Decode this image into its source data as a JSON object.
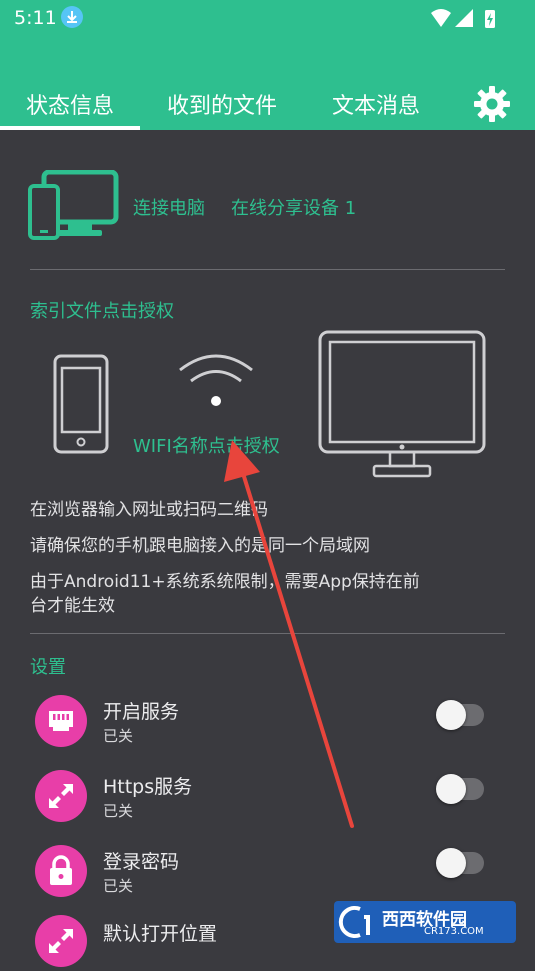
{
  "status_bar": {
    "time": "5:11"
  },
  "tabs": [
    {
      "label": "状态信息"
    },
    {
      "label": "收到的文件"
    },
    {
      "label": "文本消息"
    }
  ],
  "status_section": {
    "connect_label": "连接电脑",
    "online_label": "在线分享设备 1"
  },
  "index_section": {
    "title": "索引文件点击授权",
    "wifi_label": "WIFI名称点击授权",
    "instructions": [
      "在浏览器输入网址或扫码二维码",
      "请确保您的手机跟电脑接入的是同一个局域网",
      "由于Android11+系统系统限制，需要App保持在前",
      "台才能生效"
    ]
  },
  "settings": {
    "title": "设置",
    "items": [
      {
        "title": "开启服务",
        "subtitle": "已关",
        "icon": "ethernet-icon",
        "enabled": false
      },
      {
        "title": "Https服务",
        "subtitle": "已关",
        "icon": "expand-arrows-icon",
        "enabled": false
      },
      {
        "title": "登录密码",
        "subtitle": "已关",
        "icon": "lock-icon",
        "enabled": false
      },
      {
        "title": "默认打开位置",
        "icon": "expand-arrows-icon"
      }
    ]
  },
  "watermark": {
    "brand": "西西软件园",
    "site": "CR173.COM"
  },
  "colors": {
    "accent": "#2ebf8f",
    "background": "#3a3a3f",
    "icon_bg": "#e83ea8",
    "arrow": "#e8453c"
  }
}
